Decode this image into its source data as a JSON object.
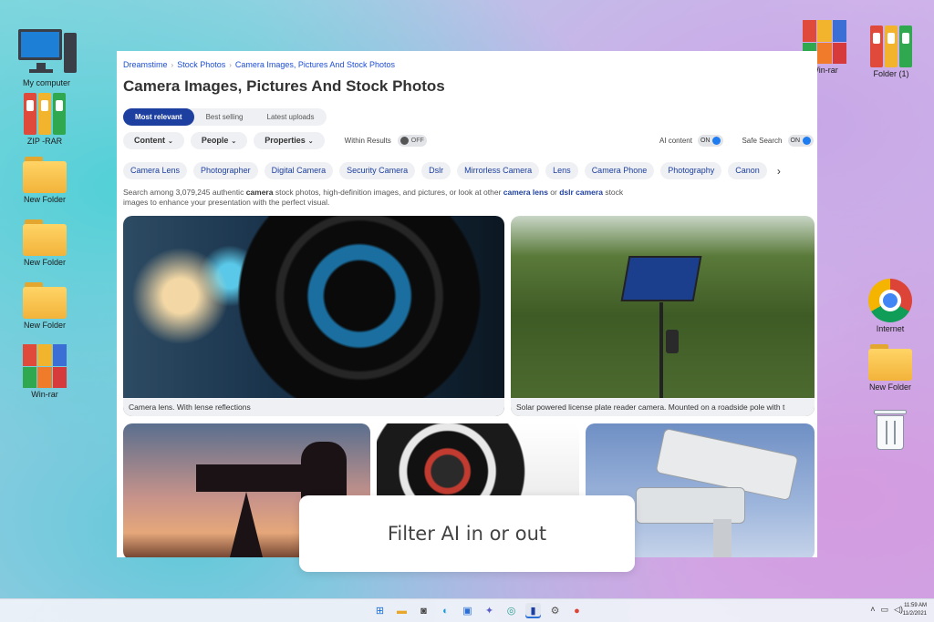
{
  "desktop": {
    "left_icons": [
      {
        "label": "My computer"
      },
      {
        "label": "ZIP -RAR"
      },
      {
        "label": "New Folder"
      },
      {
        "label": "New Folder"
      },
      {
        "label": "New Folder"
      },
      {
        "label": "Win-rar"
      }
    ],
    "right_icons": [
      {
        "label": "Win-rar"
      },
      {
        "label": "Folder (1)"
      },
      {
        "label": "Internet"
      },
      {
        "label": "New Folder"
      },
      {
        "label": ""
      }
    ]
  },
  "browser": {
    "breadcrumb": [
      "Dreamstime",
      "Stock Photos",
      "Camera Images, Pictures And Stock Photos"
    ],
    "title": "Camera Images, Pictures And Stock Photos",
    "sort_tabs": [
      "Most relevant",
      "Best selling",
      "Latest uploads"
    ],
    "filters": {
      "content": "Content",
      "people": "People",
      "properties": "Properties",
      "within_results": "Within Results",
      "within_state": "OFF",
      "ai_content": "AI content",
      "ai_state": "ON",
      "safe_search": "Safe Search",
      "safe_state": "ON"
    },
    "tags": [
      "Camera Lens",
      "Photographer",
      "Digital Camera",
      "Security Camera",
      "Dslr",
      "Mirrorless Camera",
      "Lens",
      "Camera Phone",
      "Photography",
      "Canon"
    ],
    "desc": {
      "p1": "Search among 3,079,245 authentic ",
      "b1": "camera",
      "p2": " stock photos, high-definition images, and pictures, or look at other ",
      "l1": "camera lens",
      "p3": " or ",
      "l2": "dslr camera",
      "p4": " stock images to enhance your presentation with the perfect visual."
    },
    "photos": [
      {
        "caption": "Camera lens. With lense reflections"
      },
      {
        "caption": "Solar powered license plate reader camera. Mounted on a roadside pole with t"
      }
    ]
  },
  "overlay": {
    "text": "Filter AI in or out"
  },
  "taskbar": {
    "time": "11:59 AM",
    "date": "11/2/2021"
  },
  "colors": {
    "accent": "#1d3f9f",
    "toggle_on": "#1e7cf0"
  }
}
